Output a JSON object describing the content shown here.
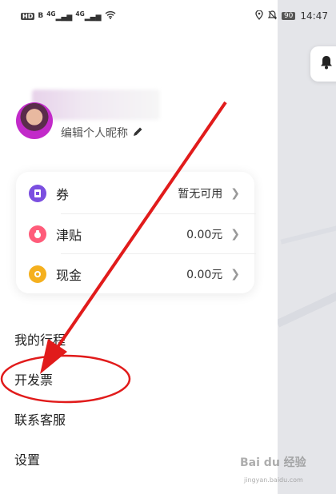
{
  "status_bar": {
    "hd_badge": "HD",
    "hd_sub": "B",
    "signal1": "4G",
    "signal2": "4G",
    "battery": "90",
    "time": "14:47"
  },
  "profile": {
    "edit_nickname": "编辑个人昵称"
  },
  "wallet_card": {
    "rows": [
      {
        "label": "券",
        "value": "暂无可用",
        "icon": "coupon-icon",
        "color": "#7b4fe0"
      },
      {
        "label": "津贴",
        "value": "0.00元",
        "icon": "allowance-icon",
        "color": "#ff5c7a"
      },
      {
        "label": "现金",
        "value": "0.00元",
        "icon": "cash-icon",
        "color": "#f5b01e"
      }
    ]
  },
  "menu": {
    "items": [
      {
        "label": "我的行程"
      },
      {
        "label": "开发票"
      },
      {
        "label": "联系客服"
      },
      {
        "label": "设置"
      }
    ]
  },
  "annotation": {
    "arrow_color": "#e11b1b",
    "circle_color": "#e11b1b"
  },
  "watermark": {
    "brand": "Bai du 经验",
    "url": "jingyan.baidu.com"
  }
}
